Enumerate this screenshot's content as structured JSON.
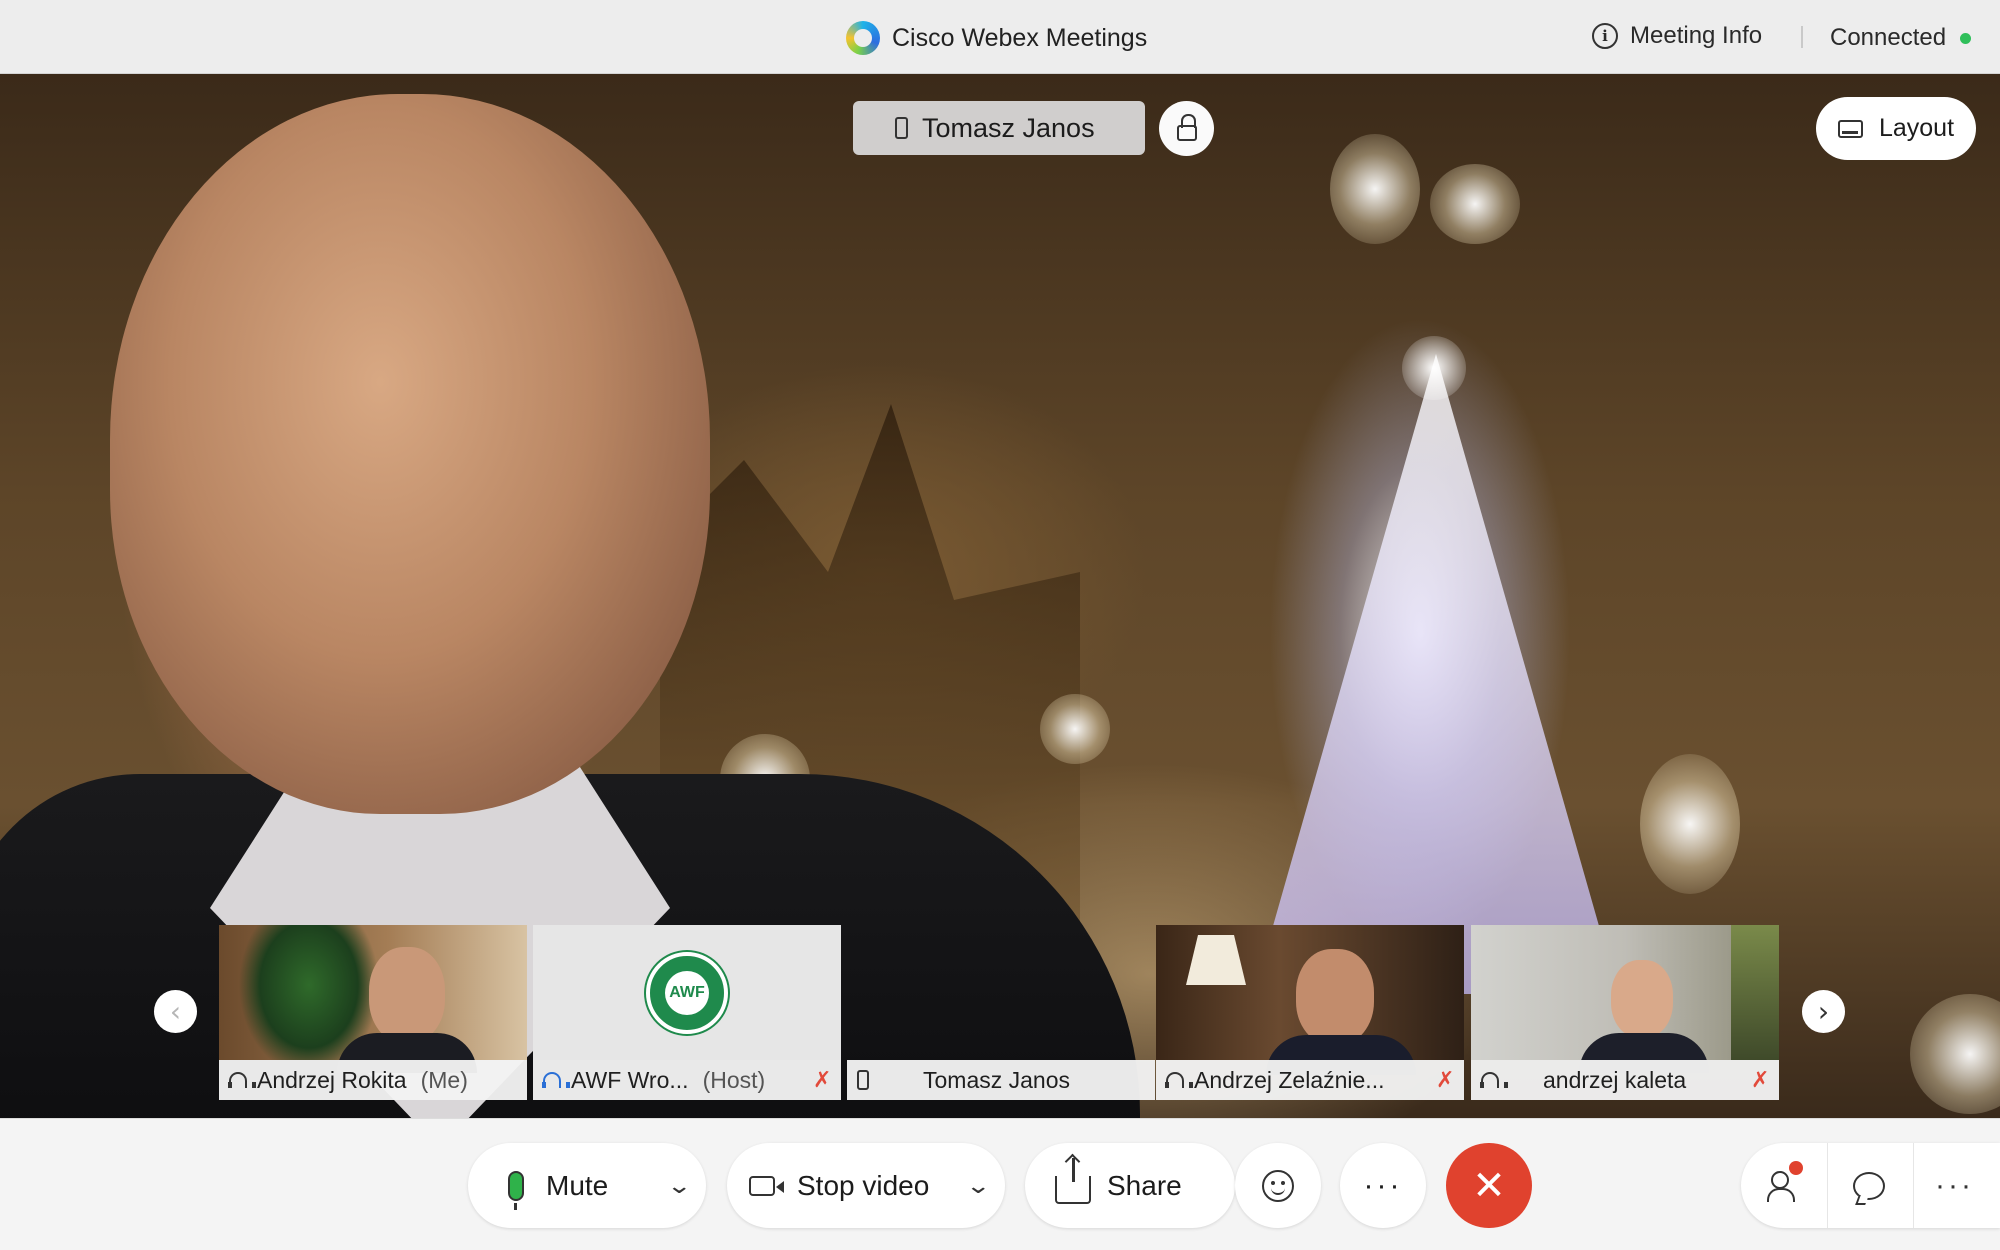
{
  "window": {
    "app_title": "Cisco Webex Meetings",
    "meeting_info_label": "Meeting Info",
    "status_label": "Connected",
    "status_color": "#2fbf5a"
  },
  "stage": {
    "active_speaker": "Tomasz Janos",
    "layout_label": "Layout"
  },
  "participants": [
    {
      "name": "Andrzej Rokita",
      "tag": "(Me)",
      "audio": "headset-icon",
      "muted": false
    },
    {
      "name": "AWF Wro...",
      "tag": "(Host)",
      "audio": "headset-icon",
      "muted": true
    },
    {
      "name": "Tomasz Janos",
      "tag": "",
      "audio": "phone-icon",
      "muted": false
    },
    {
      "name": "Andrzej Zelaźnie...",
      "tag": "",
      "audio": "headset-icon",
      "muted": true
    },
    {
      "name": "andrzej kaleta",
      "tag": "",
      "audio": "headset-icon",
      "muted": true
    }
  ],
  "toolbar": {
    "mute_label": "Mute",
    "stop_video_label": "Stop video",
    "share_label": "Share",
    "more_label": "···",
    "leave_label": "✕",
    "leave_color": "#e0422e"
  },
  "icons": {
    "next": "›",
    "prev": "‹",
    "muted_mic": "✗"
  }
}
